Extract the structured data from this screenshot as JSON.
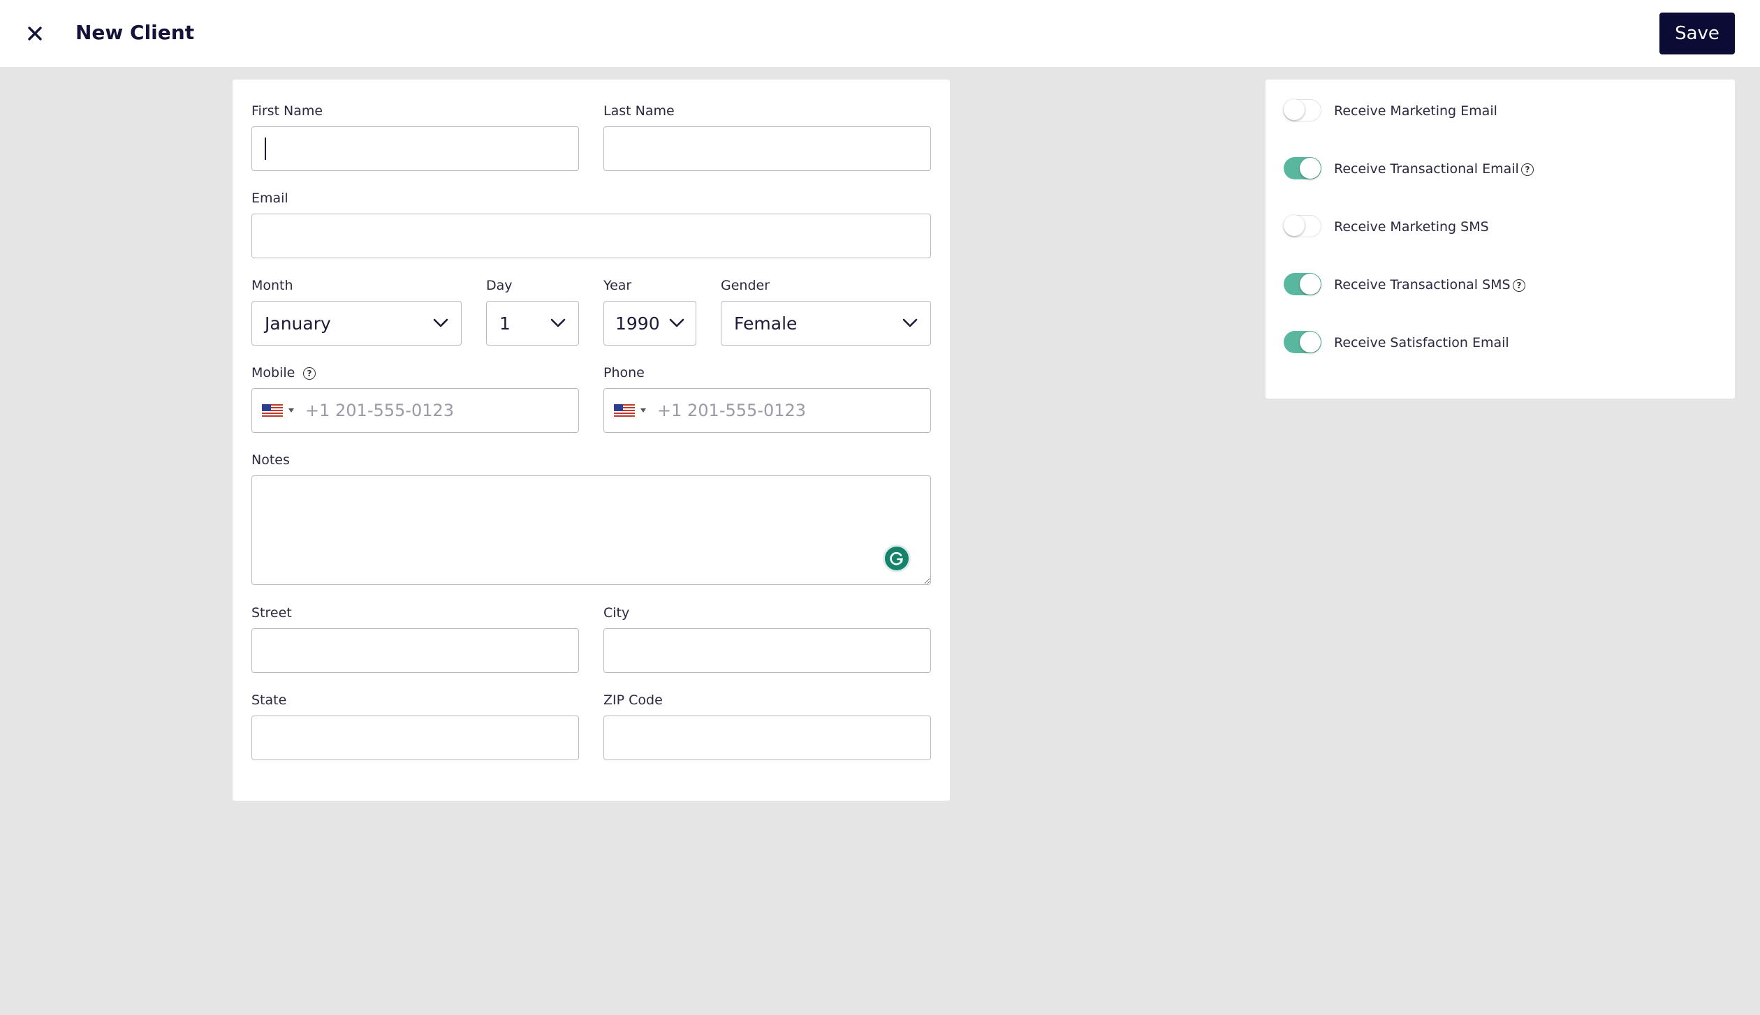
{
  "header": {
    "title": "New Client",
    "save_label": "Save",
    "close_icon": "close-icon"
  },
  "form": {
    "first_name": {
      "label": "First Name",
      "value": ""
    },
    "last_name": {
      "label": "Last Name",
      "value": ""
    },
    "email": {
      "label": "Email",
      "value": ""
    },
    "month": {
      "label": "Month",
      "value": "January"
    },
    "day": {
      "label": "Day",
      "value": "1"
    },
    "year": {
      "label": "Year",
      "value": "1990"
    },
    "gender": {
      "label": "Gender",
      "value": "Female"
    },
    "mobile": {
      "label": "Mobile",
      "placeholder": "+1 201-555-0123",
      "country": "US"
    },
    "phone": {
      "label": "Phone",
      "placeholder": "+1 201-555-0123",
      "country": "US"
    },
    "notes": {
      "label": "Notes",
      "value": ""
    },
    "street": {
      "label": "Street",
      "value": ""
    },
    "city": {
      "label": "City",
      "value": ""
    },
    "state": {
      "label": "State",
      "value": ""
    },
    "zip": {
      "label": "ZIP Code",
      "value": ""
    }
  },
  "preferences": [
    {
      "label": "Receive Marketing Email",
      "on": false,
      "help": false
    },
    {
      "label": "Receive Transactional Email",
      "on": true,
      "help": true
    },
    {
      "label": "Receive Marketing SMS",
      "on": false,
      "help": false
    },
    {
      "label": "Receive Transactional SMS",
      "on": true,
      "help": true
    },
    {
      "label": "Receive Satisfaction Email",
      "on": true,
      "help": false
    }
  ],
  "colors": {
    "primary_button": "#0c0b35",
    "toggle_on": "#5ab79f",
    "background": "#e5e5e5",
    "grammarly": "#15836c"
  }
}
